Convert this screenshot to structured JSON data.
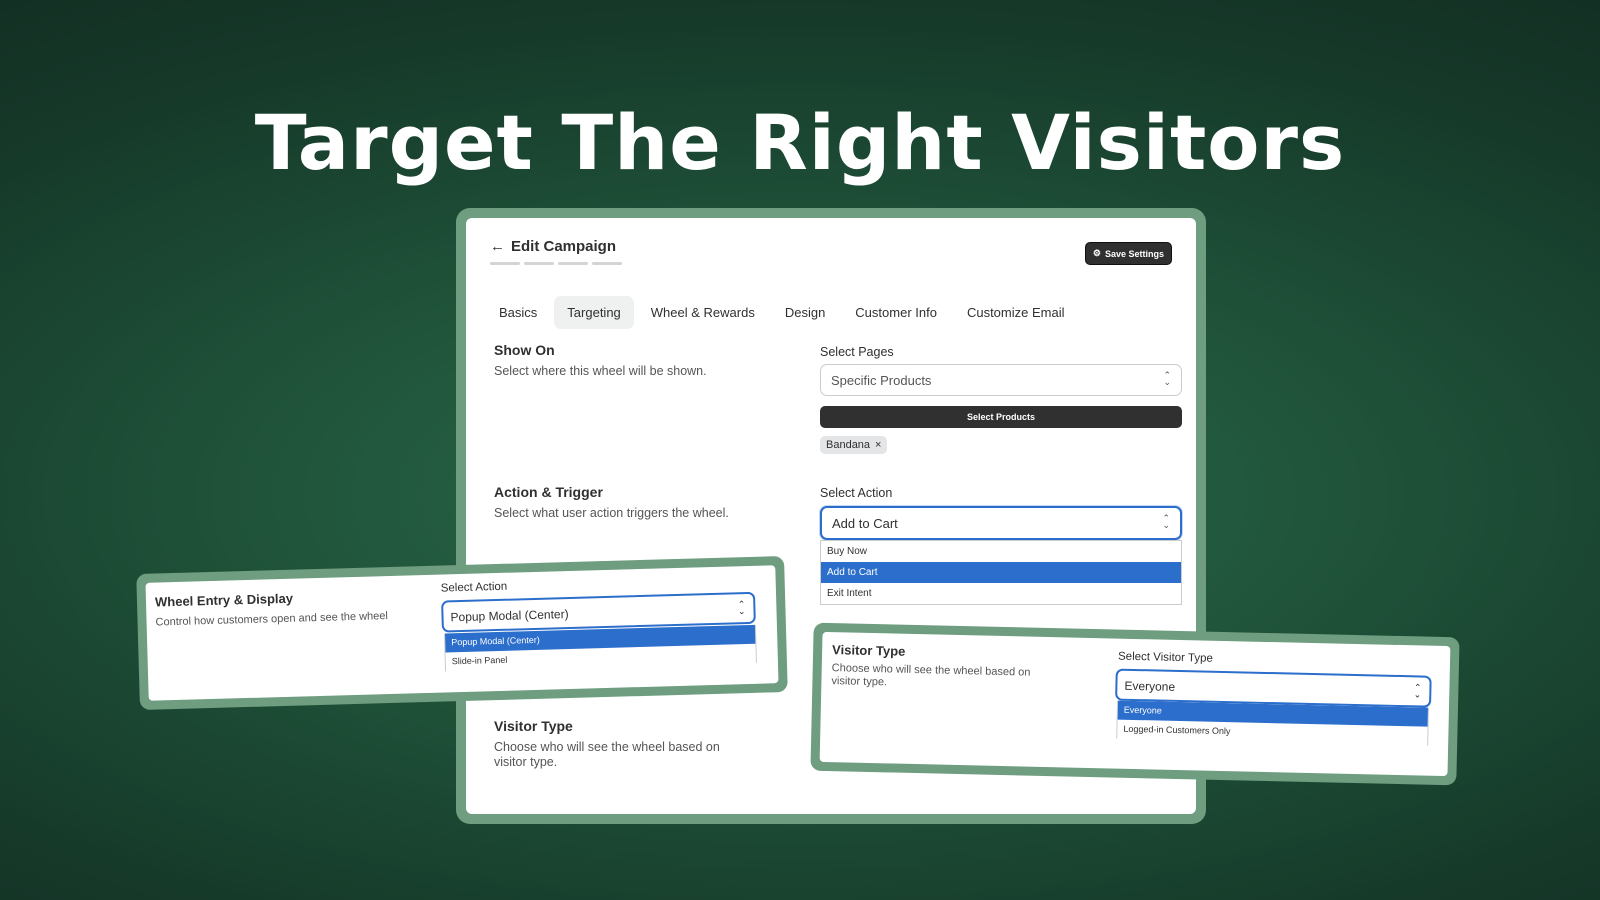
{
  "headline": "Target The Right Visitors",
  "header": {
    "back_icon": "←",
    "title": "Edit Campaign",
    "save_label": "Save Settings",
    "save_icon": "⚙"
  },
  "tabs": [
    "Basics",
    "Targeting",
    "Wheel & Rewards",
    "Design",
    "Customer Info",
    "Customize Email"
  ],
  "show_on": {
    "title": "Show On",
    "description": "Select where this wheel will be shown.",
    "field_label": "Select Pages",
    "value": "Specific Products",
    "button": "Select Products",
    "chip": "Bandana",
    "chip_remove": "×"
  },
  "action": {
    "title": "Action & Trigger",
    "description": "Select what user action triggers the wheel.",
    "field_label": "Select Action",
    "value": "Add to Cart",
    "options": [
      "Buy Now",
      "Add to Cart",
      "Exit Intent"
    ],
    "selected_index": 1
  },
  "visitor": {
    "title": "Visitor Type",
    "description": "Choose who will see the wheel based on visitor type."
  },
  "wheel_entry_card": {
    "title": "Wheel Entry & Display",
    "description": "Control how customers open and see the wheel",
    "field_label": "Select Action",
    "value": "Popup Modal (Center)",
    "options": [
      "Popup Modal (Center)",
      "Slide-in Panel"
    ],
    "selected_index": 0
  },
  "visitor_card": {
    "title": "Visitor Type",
    "description": "Choose who will see the wheel based on visitor type.",
    "field_label": "Select Visitor Type",
    "value": "Everyone",
    "options": [
      "Everyone",
      "Logged-in Customers Only"
    ],
    "selected_index": 0
  },
  "chevron": "⌃⌄",
  "colors": {
    "accent": "#2c6ecb",
    "frame": "#6e9d80",
    "background": "#1f5239"
  }
}
